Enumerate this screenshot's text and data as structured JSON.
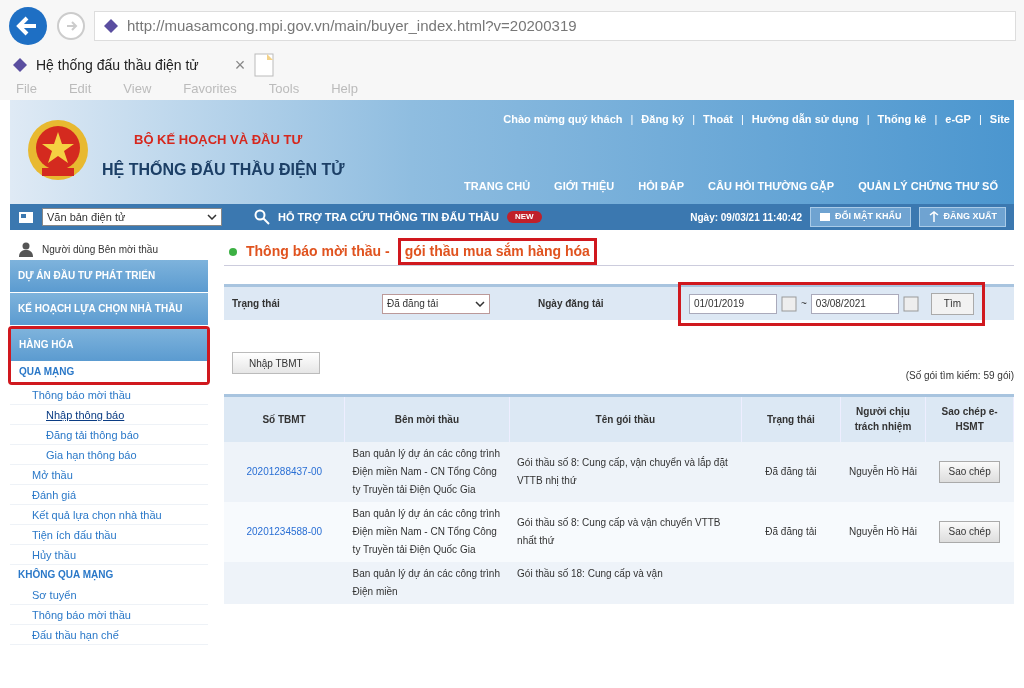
{
  "browser": {
    "url": "http://muasamcong.mpi.gov.vn/main/buyer_index.html?v=20200319",
    "tab_title": "Hệ thống đấu thầu điện tử",
    "close": "×",
    "menu": [
      "File",
      "Edit",
      "View",
      "Favorites",
      "Tools",
      "Help"
    ]
  },
  "header": {
    "separator": "|",
    "top_links": [
      "Chào mừng quý khách",
      "Đăng ký",
      "Thoát",
      "Hướng dẫn sử dụng",
      "Thống kê",
      "e-GP",
      "Site"
    ],
    "ministry": "BỘ KẾ HOẠCH VÀ ĐẦU TƯ",
    "system": "HỆ THỐNG ĐẤU THẦU ĐIỆN TỬ",
    "nav": [
      "TRANG CHỦ",
      "GIỚI THIỆU",
      "HỎI ĐÁP",
      "CÂU HỎI THƯỜNG GẶP",
      "QUẢN LÝ CHỨNG THƯ SỐ"
    ]
  },
  "toolbar": {
    "select": "Văn bản điện tử",
    "support": "HỖ TRỢ TRA CỨU THÔNG TIN ĐẤU THẦU",
    "badge": "NEW",
    "date": "Ngày: 09/03/21 11:40:42",
    "buttons": [
      "ĐỔI MẬT KHẨU",
      "ĐĂNG XUẤT"
    ]
  },
  "sidebar": {
    "user": "Người dùng Bên mời thầu",
    "items": [
      {
        "kind": "section",
        "label": "DỰ ÁN ĐẦU TƯ PHÁT TRIỂN",
        "highlighted": false
      },
      {
        "kind": "section",
        "label": "KẾ HOẠCH LỰA CHỌN NHÀ THẦU",
        "highlighted": false
      },
      {
        "kind": "section",
        "label": "HÀNG HÓA",
        "highlighted": true
      },
      {
        "kind": "group",
        "label": "QUA MẠNG",
        "highlighted": true,
        "children": [
          {
            "label": "Thông báo mời thầu",
            "selected": false,
            "children": [
              {
                "label": "Nhập thông báo",
                "selected": true
              },
              {
                "label": "Đăng tải thông báo",
                "selected": false
              },
              {
                "label": "Gia hạn thông báo",
                "selected": false
              }
            ]
          },
          {
            "label": "Mở thầu",
            "selected": false
          },
          {
            "label": "Đánh giá",
            "selected": false
          },
          {
            "label": "Kết quả lựa chọn nhà thầu",
            "selected": false
          },
          {
            "label": "Tiện ích đấu thầu",
            "selected": false
          },
          {
            "label": "Hủy thầu",
            "selected": false
          }
        ]
      },
      {
        "kind": "group",
        "label": "KHÔNG QUA MẠNG",
        "highlighted": false,
        "children": [
          {
            "label": "Sơ tuyển",
            "selected": false
          },
          {
            "label": "Thông báo mời thầu",
            "selected": false
          },
          {
            "label": "Đấu thầu hạn chế",
            "selected": false
          }
        ]
      }
    ]
  },
  "page": {
    "title": "Thông báo mời thầu -",
    "title_highlight": "gói thầu mua sắm hàng hóa",
    "filter": {
      "status_label": "Trạng thái",
      "status_value": "Đã đăng tải",
      "date_label": "Ngày đăng tải",
      "from": "01/01/2019",
      "sep": "~",
      "to": "03/08/2021",
      "search": "Tìm",
      "highlighted": true
    },
    "new_button": "Nhập TBMT",
    "count": "(Số gói tìm kiếm: 59 gói)",
    "table": {
      "columns": [
        "Số TBMT",
        "Bên mời thầu",
        "Tên gói thầu",
        "Trạng thái",
        "Người chịu trách nhiệm",
        "Sao chép e-HSMT"
      ],
      "rows": [
        [
          "20201288437-00",
          "Ban quản lý dự án các công trình Điện miền Nam - CN Tổng Công ty Truyền tải Điện Quốc Gia",
          "Gói thầu số 8: Cung cấp, vận chuyển và lắp đặt VTTB nhị thứ",
          "Đã đăng tải",
          "Nguyễn Hồ Hải",
          "Sao chép"
        ],
        [
          "20201234588-00",
          "Ban quản lý dự án các công trình Điện miền Nam - CN Tổng Công ty Truyền tải Điện Quốc Gia",
          "Gói thầu số 8: Cung cấp và vận chuyển VTTB nhất thứ",
          "Đã đăng tải",
          "Nguyễn Hồ Hải",
          "Sao chép"
        ],
        [
          "",
          "Ban quản lý dự án các công trình Điện miền",
          "Gói thầu số 18: Cung cấp và vận",
          "",
          "",
          ""
        ]
      ]
    }
  }
}
